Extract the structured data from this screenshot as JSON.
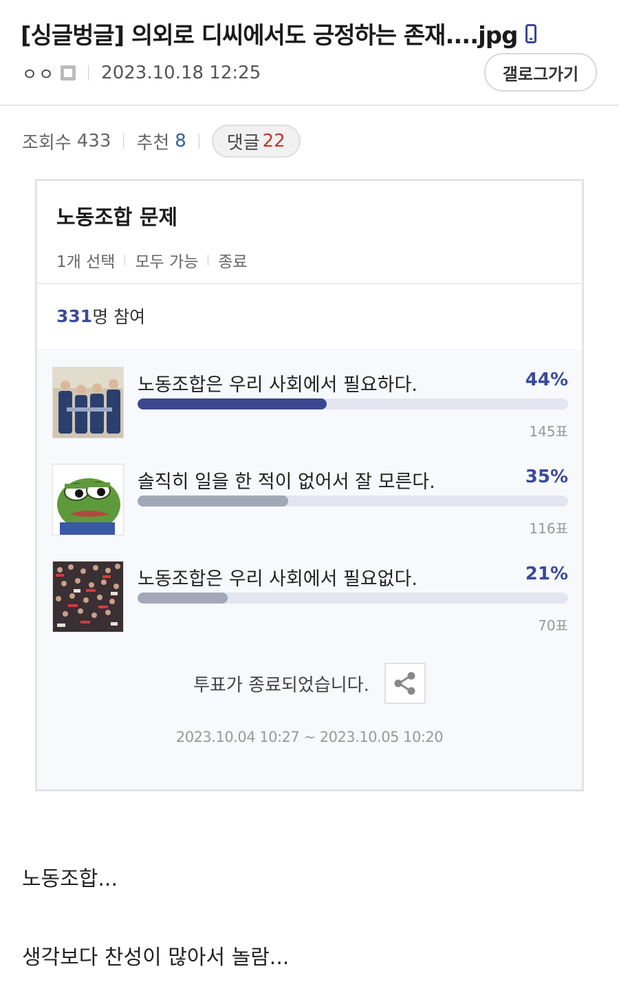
{
  "post": {
    "title": "[싱글벙글] 의외로 디씨에서도 긍정하는 존재....jpg",
    "author": "ㅇㅇ",
    "date": "2023.10.18 12:25",
    "gallery_button": "갤로그가기",
    "views_label": "조회수",
    "views": "433",
    "recommend_label": "추천",
    "recommend": "8",
    "comment_label": "댓글",
    "comments": "22"
  },
  "poll": {
    "title": "노동조합 문제",
    "meta": [
      "1개 선택",
      "모두 가능",
      "종료"
    ],
    "participants_count": "331",
    "participants_suffix": "명 참여",
    "options": [
      {
        "label": "노동조합은 우리 사회에서 필요하다.",
        "percent_text": "44%",
        "percent": 44,
        "votes": "145표",
        "bar_color": "#3b4890",
        "image": "group-photo"
      },
      {
        "label": "솔직히 일을 한 적이 없어서 잘 모른다.",
        "percent_text": "35%",
        "percent": 35,
        "votes": "116표",
        "bar_color": "#a3a8b8",
        "image": "pepe-frog"
      },
      {
        "label": "노동조합은 우리 사회에서 필요없다.",
        "percent_text": "21%",
        "percent": 21,
        "votes": "70표",
        "bar_color": "#a3a8b8",
        "image": "crowd-protest"
      }
    ],
    "closed_text": "투표가 종료되었습니다.",
    "period": "2023.10.04 10:27 ~ 2023.10.05 10:20"
  },
  "body": {
    "line1": "노동조합...",
    "line2": "생각보다 찬성이 많아서 놀람..."
  },
  "colors": {
    "accent": "#3b4890",
    "comment_count": "#c0392b",
    "recommend": "#2a5fa8"
  }
}
